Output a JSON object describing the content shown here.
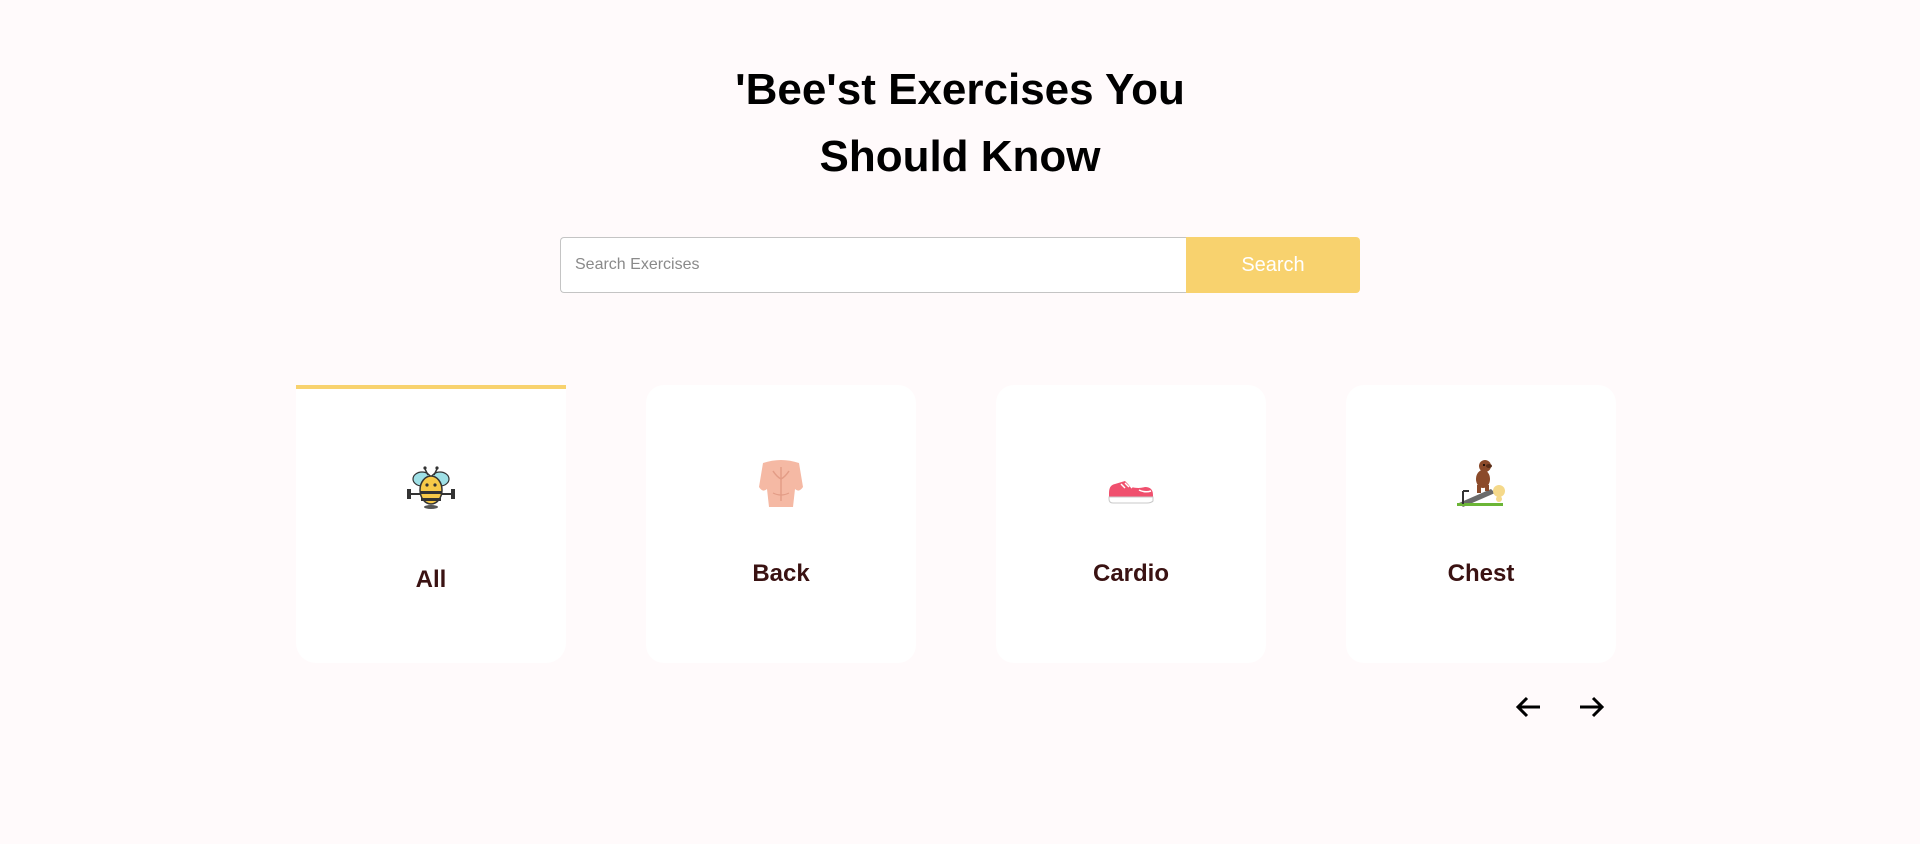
{
  "hero": {
    "title_line1": "'Bee'st Exercises You",
    "title_line2": "Should Know"
  },
  "search": {
    "placeholder": "Search Exercises",
    "value": "",
    "button_label": "Search"
  },
  "categories": [
    {
      "label": "All",
      "icon": "bee-dumbbell-icon",
      "active": true
    },
    {
      "label": "Back",
      "icon": "back-torso-icon",
      "active": false
    },
    {
      "label": "Cardio",
      "icon": "running-shoe-icon",
      "active": false
    },
    {
      "label": "Chest",
      "icon": "dog-treadmill-icon",
      "active": false
    }
  ],
  "nav": {
    "prev_icon": "arrow-left-icon",
    "next_icon": "arrow-right-icon"
  },
  "colors": {
    "accent": "#f8d26e",
    "background": "#fffafb",
    "card": "#ffffff",
    "label": "#3a1212"
  }
}
